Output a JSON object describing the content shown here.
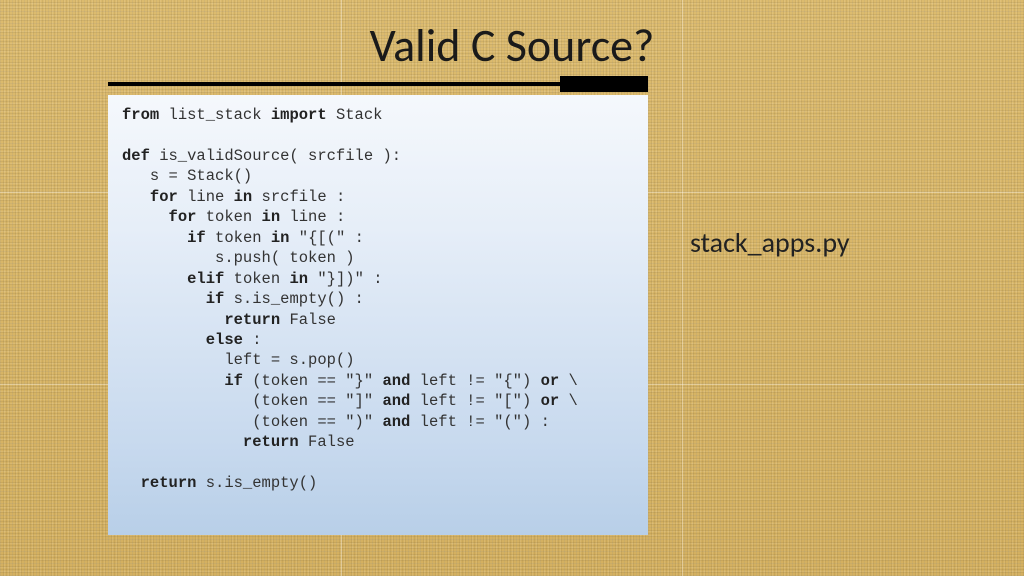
{
  "slide": {
    "title": "Valid C Source?",
    "filename": "stack_apps.py",
    "code_tokens": [
      {
        "t": "from",
        "b": true
      },
      {
        "t": " list_stack "
      },
      {
        "t": "import",
        "b": true
      },
      {
        "t": " Stack\n\n"
      },
      {
        "t": "def",
        "b": true
      },
      {
        "t": " is_validSource( srcfile ):\n"
      },
      {
        "t": "   s = Stack()\n"
      },
      {
        "t": "   "
      },
      {
        "t": "for",
        "b": true
      },
      {
        "t": " line "
      },
      {
        "t": "in",
        "b": true
      },
      {
        "t": " srcfile : \n"
      },
      {
        "t": "     "
      },
      {
        "t": "for",
        "b": true
      },
      {
        "t": " token "
      },
      {
        "t": "in",
        "b": true
      },
      {
        "t": " line :\n"
      },
      {
        "t": "       "
      },
      {
        "t": "if",
        "b": true
      },
      {
        "t": " token "
      },
      {
        "t": "in",
        "b": true
      },
      {
        "t": " \"{[(\" :\n"
      },
      {
        "t": "          s.push( token )\n"
      },
      {
        "t": "       "
      },
      {
        "t": "elif",
        "b": true
      },
      {
        "t": " token "
      },
      {
        "t": "in",
        "b": true
      },
      {
        "t": " \"}])\" :\n"
      },
      {
        "t": "         "
      },
      {
        "t": "if",
        "b": true
      },
      {
        "t": " s.is_empty() :\n"
      },
      {
        "t": "           "
      },
      {
        "t": "return",
        "b": true
      },
      {
        "t": " False\n"
      },
      {
        "t": "         "
      },
      {
        "t": "else",
        "b": true
      },
      {
        "t": " :\n"
      },
      {
        "t": "           left = s.pop()\n"
      },
      {
        "t": "           "
      },
      {
        "t": "if",
        "b": true
      },
      {
        "t": " (token == \"}\" "
      },
      {
        "t": "and",
        "b": true
      },
      {
        "t": " left != \"{\") "
      },
      {
        "t": "or",
        "b": true
      },
      {
        "t": " \\\n"
      },
      {
        "t": "              (token == \"]\" "
      },
      {
        "t": "and",
        "b": true
      },
      {
        "t": " left != \"[\") "
      },
      {
        "t": "or",
        "b": true
      },
      {
        "t": " \\\n"
      },
      {
        "t": "              (token == \")\" "
      },
      {
        "t": "and",
        "b": true
      },
      {
        "t": " left != \"(\") :\n"
      },
      {
        "t": "             "
      },
      {
        "t": "return",
        "b": true
      },
      {
        "t": " False\n\n"
      },
      {
        "t": "  "
      },
      {
        "t": "return",
        "b": true
      },
      {
        "t": " s.is_empty()"
      }
    ]
  }
}
